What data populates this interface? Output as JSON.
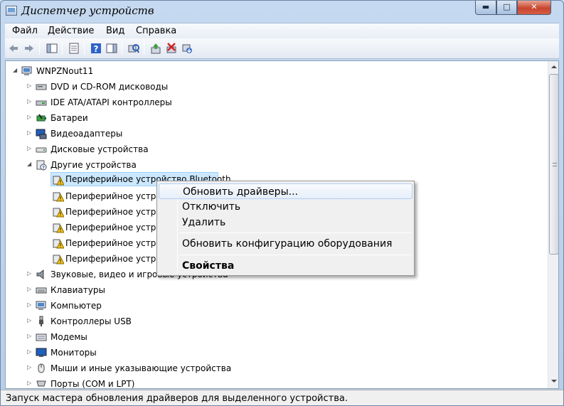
{
  "window": {
    "title": "Диспетчер устройств"
  },
  "menu": [
    "Файл",
    "Действие",
    "Вид",
    "Справка"
  ],
  "tree": {
    "root": "WNPZNout11",
    "categories": [
      "DVD и CD-ROM дисководы",
      "IDE ATA/ATAPI контроллеры",
      "Батареи",
      "Видеоадаптеры",
      "Дисковые устройства",
      "Другие устройства"
    ],
    "other_devices": [
      "Периферийное устройство Bluetooth",
      "Периферийное устройство Bluetooth",
      "Периферийное устройство Bluetooth",
      "Периферийное устройство Bluetooth",
      "Периферийное устройство Bluetooth",
      "Периферийное устройство Bluetooth"
    ],
    "categories_after": [
      "Звуковые, видео и игровые устройства",
      "Клавиатуры",
      "Компьютер",
      "Контроллеры USB",
      "Модемы",
      "Мониторы",
      "Мыши и иные указывающие устройства",
      "Порты (COM и LPT)"
    ]
  },
  "context_menu": {
    "update_drivers": "Обновить драйверы...",
    "disable": "Отключить",
    "uninstall": "Удалить",
    "scan_hardware": "Обновить конфигурацию оборудования",
    "properties": "Свойства"
  },
  "status": "Запуск мастера обновления драйверов для выделенного устройства.",
  "colors": {
    "accent": "#3399ff",
    "warning": "#f5c518",
    "selection": "#cce8ff"
  }
}
